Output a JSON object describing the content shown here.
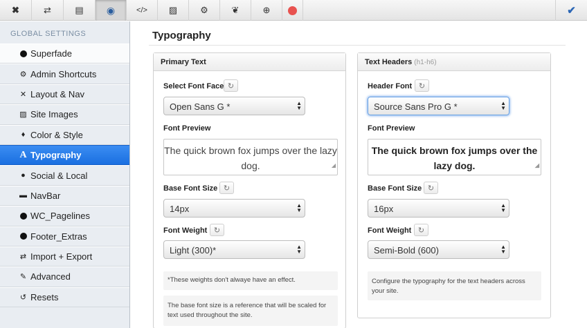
{
  "toolbar": {
    "buttons": [
      {
        "icon": "close-icon",
        "glyph": "✖"
      },
      {
        "icon": "shuffle-icon",
        "glyph": "⇄"
      },
      {
        "icon": "document-icon",
        "glyph": "▤"
      },
      {
        "icon": "globe-icon",
        "glyph": "◉"
      },
      {
        "icon": "code-icon",
        "glyph": "</>"
      },
      {
        "icon": "image-icon",
        "glyph": "▨"
      },
      {
        "icon": "gears-icon",
        "glyph": "⚙"
      },
      {
        "icon": "leaf-icon",
        "glyph": "❦"
      },
      {
        "icon": "crosshair-icon",
        "glyph": "⊕"
      },
      {
        "icon": "record-icon",
        "glyph": "●"
      }
    ],
    "confirm_icon": "checkmark-icon",
    "record_color": "#e8524f"
  },
  "sidebar": {
    "heading": "GLOBAL SETTINGS",
    "items": [
      {
        "label": "Superfade",
        "icon": "dot-icon"
      },
      {
        "label": "Admin Shortcuts",
        "icon": "gear-icon"
      },
      {
        "label": "Layout & Nav",
        "icon": "wrench-icon"
      },
      {
        "label": "Site Images",
        "icon": "image-icon"
      },
      {
        "label": "Color & Style",
        "icon": "droplet-icon"
      },
      {
        "label": "Typography",
        "icon": "font-icon"
      },
      {
        "label": "Social & Local",
        "icon": "share-icon"
      },
      {
        "label": "NavBar",
        "icon": "navbar-icon"
      },
      {
        "label": "WC_Pagelines",
        "icon": "dot-icon"
      },
      {
        "label": "Footer_Extras",
        "icon": "dot-icon"
      },
      {
        "label": "Import + Export",
        "icon": "exchange-icon"
      },
      {
        "label": "Advanced",
        "icon": "wrench-icon"
      },
      {
        "label": "Resets",
        "icon": "undo-icon"
      }
    ],
    "active_index": 5,
    "accent": "#1a6fe0"
  },
  "main": {
    "title": "Typography",
    "primary": {
      "heading": "Primary Text",
      "font_face_label": "Select Font Face",
      "font_face_value": "Open Sans G *",
      "preview_label": "Font Preview",
      "preview_text": "The quick brown fox jumps over the lazy dog.",
      "size_label": "Base Font Size",
      "size_value": "14px",
      "weight_label": "Font Weight",
      "weight_value": "Light (300)*",
      "note1": "*These weights don't alwaye have an effect.",
      "note2": "The base font size is a reference that will be scaled for text used throughout the site."
    },
    "headers": {
      "heading": "Text Headers",
      "heading_sub": "(h1-h6)",
      "font_label": "Header Font",
      "font_value": "Source Sans Pro G *",
      "preview_label": "Font Preview",
      "preview_text": "The quick brown fox jumps over the lazy dog.",
      "size_label": "Base Font Size",
      "size_value": "16px",
      "weight_label": "Font Weight",
      "weight_value": "Semi-Bold (600)",
      "note": "Configure the typography for the text headers across your site."
    }
  }
}
